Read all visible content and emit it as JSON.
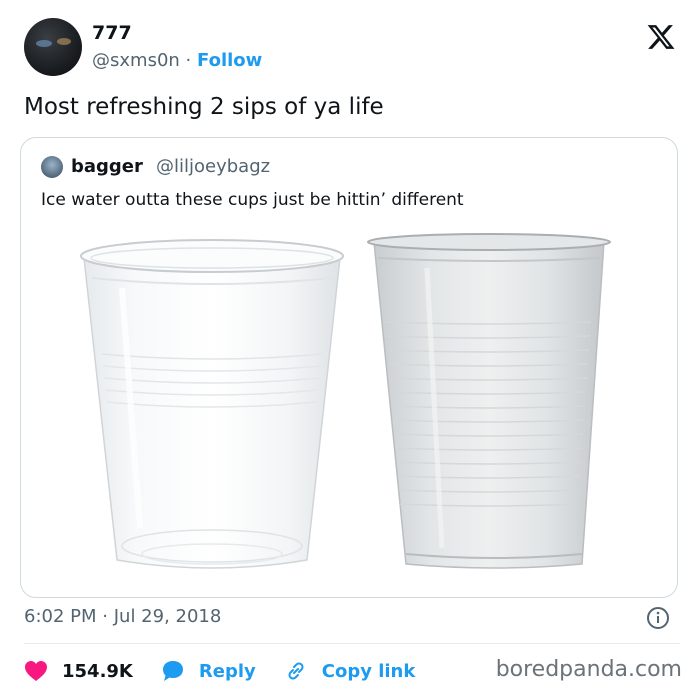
{
  "author": {
    "display_name": "777",
    "handle": "@sxms0n",
    "separator": "·",
    "follow_label": "Follow"
  },
  "tweet": {
    "text": "Most refreshing 2 sips of ya life",
    "time": "6:02 PM",
    "date": "Jul 29, 2018"
  },
  "quoted": {
    "display_name": "bagger",
    "handle": "@liljoeybagz",
    "text": "Ice water outta these cups just be hittin’ different"
  },
  "actions": {
    "likes": "154.9K",
    "reply_label": "Reply",
    "copy_label": "Copy link"
  },
  "watermark": "boredpanda.com",
  "icons": {
    "logo": "x-logo-icon",
    "info": "info-icon",
    "like": "heart-icon",
    "reply": "reply-bubble-icon",
    "copy": "link-icon"
  },
  "colors": {
    "accent": "#1d9bf0",
    "like": "#f91880",
    "muted": "#536471"
  }
}
